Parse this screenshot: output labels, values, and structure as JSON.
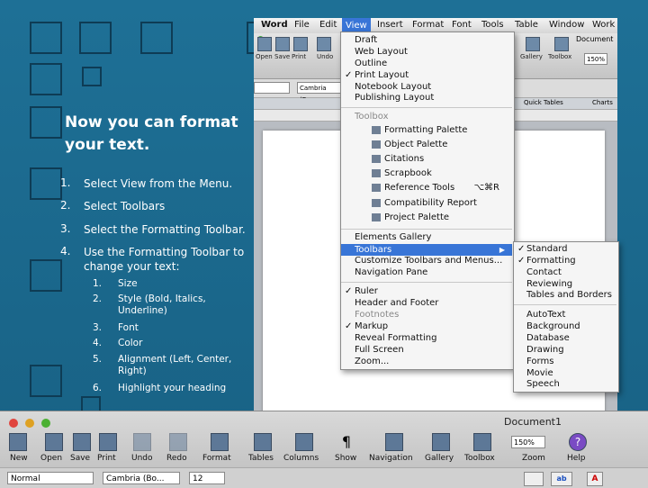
{
  "slide": {
    "title": "Now you can format your text.",
    "steps": [
      {
        "num": "1.",
        "text": "Select View from the Menu."
      },
      {
        "num": "2.",
        "text": "Select Toolbars"
      },
      {
        "num": "3.",
        "text": "Select the Formatting Toolbar."
      },
      {
        "num": "4.",
        "text": "Use the Formatting Toolbar to change your text:"
      }
    ],
    "substeps": [
      {
        "num": "1.",
        "text": "Size"
      },
      {
        "num": "2.",
        "text": "Style (Bold, Italics, Underline)"
      },
      {
        "num": "3.",
        "text": "Font"
      },
      {
        "num": "4.",
        "text": "Color"
      },
      {
        "num": "5.",
        "text": "Alignment (Left, Center, Right)"
      },
      {
        "num": "6.",
        "text": "Highlight your heading"
      }
    ]
  },
  "word": {
    "menubar": [
      "Word",
      "File",
      "Edit",
      "View",
      "Insert",
      "Format",
      "Font",
      "Tools",
      "Table",
      "Window",
      "Work"
    ],
    "active_menu": "View",
    "document_title": "Document",
    "toolbar_labels": [
      "Open",
      "Save",
      "Print",
      "Undo",
      "Gallery",
      "Toolbox"
    ],
    "style_value": "Cambria (Bo...",
    "zoom_value": "150%",
    "ribbon_tabs": [
      "Quick Tables",
      "Charts"
    ]
  },
  "view_menu": {
    "items_top": [
      "Draft",
      "Web Layout",
      "Outline",
      "Print Layout",
      "Notebook Layout",
      "Publishing Layout"
    ],
    "checked_top": "Print Layout",
    "toolbox_header": "Toolbox",
    "toolbox_items": [
      "Formatting Palette",
      "Object Palette",
      "Citations",
      "Scrapbook",
      "Reference Tools",
      "Compatibility Report",
      "Project Palette"
    ],
    "reference_shortcut": "⌥⌘R",
    "elements_gallery": "Elements Gallery",
    "toolbars": "Toolbars",
    "customize": "Customize Toolbars and Menus...",
    "navigation_pane": "Navigation Pane",
    "items_bottom": [
      "Ruler",
      "Header and Footer",
      "Footnotes",
      "Markup",
      "Reveal Formatting",
      "Full Screen",
      "Zoom..."
    ]
  },
  "toolbars_submenu": {
    "items": [
      "Standard",
      "Formatting",
      "Contact",
      "Reviewing",
      "Tables and Borders"
    ],
    "checked": [
      "Standard",
      "Formatting"
    ],
    "items2": [
      "AutoText",
      "Background",
      "Database",
      "Drawing",
      "Forms",
      "Movie",
      "Speech"
    ]
  },
  "bottom_window": {
    "title": "Document1",
    "buttons": [
      "New",
      "Open",
      "Save",
      "Print",
      "Undo",
      "Redo",
      "Format",
      "Tables",
      "Columns",
      "Show",
      "Navigation",
      "Gallery",
      "Toolbox",
      "Zoom",
      "Help"
    ],
    "zoom": "150%",
    "style": "Normal",
    "font": "Cambria (Bo...",
    "size": "12"
  }
}
